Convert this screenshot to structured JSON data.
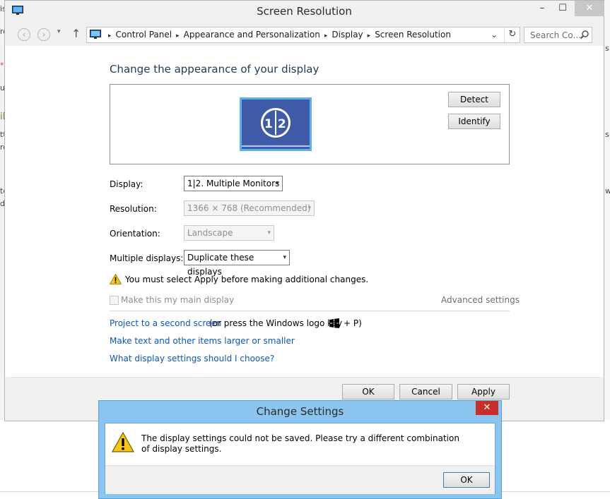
{
  "background": {
    "left_fragments": [
      "is",
      "ro",
      "*",
      "ur",
      "il",
      "tt",
      "ro",
      "to",
      "d"
    ],
    "right_fragments": [
      "s",
      "s",
      "w"
    ]
  },
  "window": {
    "title": "Screen Resolution",
    "controls": {
      "minimize": "–",
      "maximize": "☐",
      "close": "✕"
    }
  },
  "nav": {
    "back_icon": "‹",
    "forward_icon": "›",
    "recent_icon": "▾",
    "up_icon": "↑",
    "breadcrumbs": [
      "Control Panel",
      "Appearance and Personalization",
      "Display",
      "Screen Resolution"
    ],
    "separator": "▸",
    "dropdown_icon": "⌄",
    "refresh_icon": "↻",
    "search_placeholder": "Search Co..."
  },
  "content": {
    "heading": "Change the appearance of your display",
    "monitor_label": "12",
    "detect_label": "Detect",
    "identify_label": "Identify",
    "display": {
      "label": "Display:",
      "value": "1|2. Multiple Monitors"
    },
    "resolution": {
      "label": "Resolution:",
      "value": "1366 × 768 (Recommended)"
    },
    "orientation": {
      "label": "Orientation:",
      "value": "Landscape"
    },
    "multiple_displays": {
      "label": "Multiple displays:",
      "value": "Duplicate these displays"
    },
    "dropdown_arrow": "▾",
    "warning": "You must select Apply before making additional changes.",
    "main_display_label": "Make this my main display",
    "advanced_settings": "Advanced settings",
    "project_link": "Project to a second screen",
    "project_suffix_before": "(or press the Windows logo key",
    "project_suffix_after": "+ P)",
    "text_size_link": "Make text and other items larger or smaller",
    "help_link": "What display settings should I choose?",
    "ok_label": "OK",
    "cancel_label": "Cancel",
    "apply_label": "Apply"
  },
  "dialog": {
    "title": "Change Settings",
    "close_icon": "✕",
    "message": "The display settings could not be saved.  Please try a different combination of display settings.",
    "ok_label": "OK"
  },
  "colors": {
    "accent_link": "#0a57b3",
    "heading": "#1e395b",
    "dialog_frame": "#8cc4f0",
    "close_red": "#c7302a",
    "monitor_blue": "#3f5ba8"
  }
}
